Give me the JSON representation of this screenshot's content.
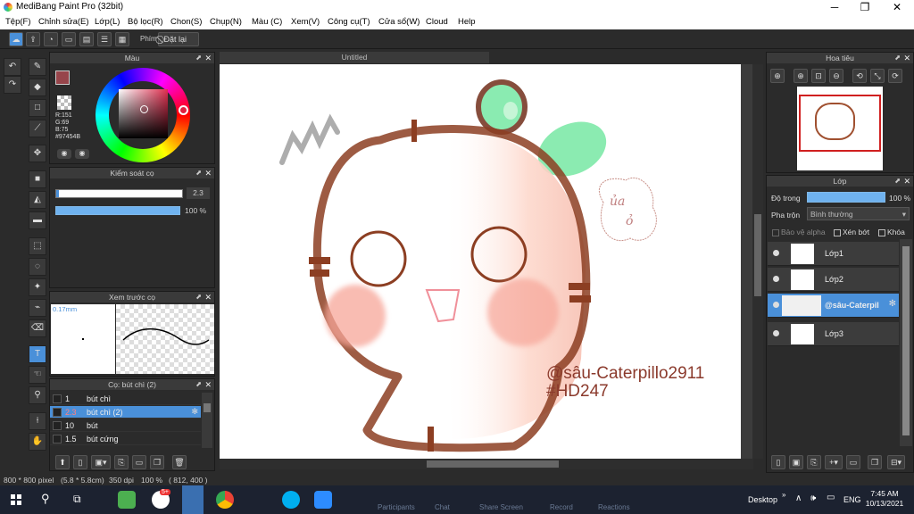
{
  "window": {
    "title": "MediBang Paint Pro (32bit)",
    "minimize": "─",
    "maximize": "❐",
    "close": "✕"
  },
  "menu": [
    "Tệp(F)",
    "Chỉnh sửa(E)",
    "Lớp(L)",
    "Bộ lọc(R)",
    "Chon(S)",
    "Chụp(N)",
    "Màu (C)",
    "Xem(V)",
    "Công cụ(T)",
    "Cửa sổ(W)",
    "Cloud",
    "Help"
  ],
  "toolbar": {
    "shortcut_label": "Phím",
    "reset_label": "Đặt lại"
  },
  "color_panel": {
    "title": "Màu",
    "r": "R:151",
    "g": "G:69",
    "b": "B:75",
    "hex": "#97454B",
    "primary_color": "#97454B"
  },
  "brush_control": {
    "title": "Kiểm soát cọ",
    "size_value": "2.3",
    "opacity_value": "100 %"
  },
  "brush_preview": {
    "title": "Xem trước cọ",
    "size_label": "0.17mm"
  },
  "brush_list": {
    "title": "Cọ: bút chì (2)",
    "items": [
      {
        "size": "1",
        "name": "bút chì"
      },
      {
        "size": "2.3",
        "name": "bút chì (2)"
      },
      {
        "size": "10",
        "name": "bút"
      },
      {
        "size": "1.5",
        "name": "bút cứng"
      }
    ]
  },
  "canvas": {
    "tab_title": "Untitled",
    "watermark_line1": "@sâu-Caterpillo2911",
    "watermark_line2": "#HD247"
  },
  "navigator": {
    "title": "Hoa tiêu"
  },
  "layers": {
    "title": "Lớp",
    "opacity_label": "Độ trong",
    "opacity_value": "100 %",
    "blend_label": "Pha trộn",
    "blend_value": "Bình thường",
    "protect_alpha": "Bảo vệ alpha",
    "clipping": "Xén bớt",
    "lock": "Khóa",
    "items": [
      {
        "name": "Lớp1"
      },
      {
        "name": "Lớp2"
      },
      {
        "name": "@sâu-Caterpil"
      },
      {
        "name": "Lớp3"
      }
    ]
  },
  "status": {
    "size": "800 * 800 pixel",
    "dims": "(5.8 * 5.8cm)",
    "dpi": "350 dpi",
    "zoom": "100 %",
    "coords": "( 812, 400 )"
  },
  "taskbar": {
    "background_items": [
      "Participants",
      "Chat",
      "Share Screen",
      "Record",
      "Reactions"
    ],
    "desktop_label": "Desktop",
    "lang": "ENG",
    "time": "7:45 AM",
    "date": "10/13/2021",
    "badge": "5+"
  }
}
